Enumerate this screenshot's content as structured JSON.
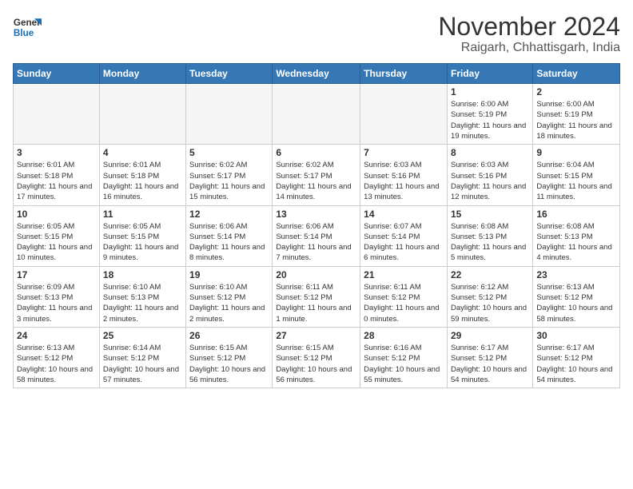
{
  "header": {
    "logo_line1": "General",
    "logo_line2": "Blue",
    "title": "November 2024",
    "subtitle": "Raigarh, Chhattisgarh, India"
  },
  "weekdays": [
    "Sunday",
    "Monday",
    "Tuesday",
    "Wednesday",
    "Thursday",
    "Friday",
    "Saturday"
  ],
  "weeks": [
    [
      {
        "day": "",
        "empty": true
      },
      {
        "day": "",
        "empty": true
      },
      {
        "day": "",
        "empty": true
      },
      {
        "day": "",
        "empty": true
      },
      {
        "day": "",
        "empty": true
      },
      {
        "day": "1",
        "info": "Sunrise: 6:00 AM\nSunset: 5:19 PM\nDaylight: 11 hours\nand 19 minutes."
      },
      {
        "day": "2",
        "info": "Sunrise: 6:00 AM\nSunset: 5:19 PM\nDaylight: 11 hours\nand 18 minutes."
      }
    ],
    [
      {
        "day": "3",
        "info": "Sunrise: 6:01 AM\nSunset: 5:18 PM\nDaylight: 11 hours\nand 17 minutes."
      },
      {
        "day": "4",
        "info": "Sunrise: 6:01 AM\nSunset: 5:18 PM\nDaylight: 11 hours\nand 16 minutes."
      },
      {
        "day": "5",
        "info": "Sunrise: 6:02 AM\nSunset: 5:17 PM\nDaylight: 11 hours\nand 15 minutes."
      },
      {
        "day": "6",
        "info": "Sunrise: 6:02 AM\nSunset: 5:17 PM\nDaylight: 11 hours\nand 14 minutes."
      },
      {
        "day": "7",
        "info": "Sunrise: 6:03 AM\nSunset: 5:16 PM\nDaylight: 11 hours\nand 13 minutes."
      },
      {
        "day": "8",
        "info": "Sunrise: 6:03 AM\nSunset: 5:16 PM\nDaylight: 11 hours\nand 12 minutes."
      },
      {
        "day": "9",
        "info": "Sunrise: 6:04 AM\nSunset: 5:15 PM\nDaylight: 11 hours\nand 11 minutes."
      }
    ],
    [
      {
        "day": "10",
        "info": "Sunrise: 6:05 AM\nSunset: 5:15 PM\nDaylight: 11 hours\nand 10 minutes."
      },
      {
        "day": "11",
        "info": "Sunrise: 6:05 AM\nSunset: 5:15 PM\nDaylight: 11 hours\nand 9 minutes."
      },
      {
        "day": "12",
        "info": "Sunrise: 6:06 AM\nSunset: 5:14 PM\nDaylight: 11 hours\nand 8 minutes."
      },
      {
        "day": "13",
        "info": "Sunrise: 6:06 AM\nSunset: 5:14 PM\nDaylight: 11 hours\nand 7 minutes."
      },
      {
        "day": "14",
        "info": "Sunrise: 6:07 AM\nSunset: 5:14 PM\nDaylight: 11 hours\nand 6 minutes."
      },
      {
        "day": "15",
        "info": "Sunrise: 6:08 AM\nSunset: 5:13 PM\nDaylight: 11 hours\nand 5 minutes."
      },
      {
        "day": "16",
        "info": "Sunrise: 6:08 AM\nSunset: 5:13 PM\nDaylight: 11 hours\nand 4 minutes."
      }
    ],
    [
      {
        "day": "17",
        "info": "Sunrise: 6:09 AM\nSunset: 5:13 PM\nDaylight: 11 hours\nand 3 minutes."
      },
      {
        "day": "18",
        "info": "Sunrise: 6:10 AM\nSunset: 5:13 PM\nDaylight: 11 hours\nand 2 minutes."
      },
      {
        "day": "19",
        "info": "Sunrise: 6:10 AM\nSunset: 5:12 PM\nDaylight: 11 hours\nand 2 minutes."
      },
      {
        "day": "20",
        "info": "Sunrise: 6:11 AM\nSunset: 5:12 PM\nDaylight: 11 hours\nand 1 minute."
      },
      {
        "day": "21",
        "info": "Sunrise: 6:11 AM\nSunset: 5:12 PM\nDaylight: 11 hours\nand 0 minutes."
      },
      {
        "day": "22",
        "info": "Sunrise: 6:12 AM\nSunset: 5:12 PM\nDaylight: 10 hours\nand 59 minutes."
      },
      {
        "day": "23",
        "info": "Sunrise: 6:13 AM\nSunset: 5:12 PM\nDaylight: 10 hours\nand 58 minutes."
      }
    ],
    [
      {
        "day": "24",
        "info": "Sunrise: 6:13 AM\nSunset: 5:12 PM\nDaylight: 10 hours\nand 58 minutes."
      },
      {
        "day": "25",
        "info": "Sunrise: 6:14 AM\nSunset: 5:12 PM\nDaylight: 10 hours\nand 57 minutes."
      },
      {
        "day": "26",
        "info": "Sunrise: 6:15 AM\nSunset: 5:12 PM\nDaylight: 10 hours\nand 56 minutes."
      },
      {
        "day": "27",
        "info": "Sunrise: 6:15 AM\nSunset: 5:12 PM\nDaylight: 10 hours\nand 56 minutes."
      },
      {
        "day": "28",
        "info": "Sunrise: 6:16 AM\nSunset: 5:12 PM\nDaylight: 10 hours\nand 55 minutes."
      },
      {
        "day": "29",
        "info": "Sunrise: 6:17 AM\nSunset: 5:12 PM\nDaylight: 10 hours\nand 54 minutes."
      },
      {
        "day": "30",
        "info": "Sunrise: 6:17 AM\nSunset: 5:12 PM\nDaylight: 10 hours\nand 54 minutes."
      }
    ]
  ]
}
